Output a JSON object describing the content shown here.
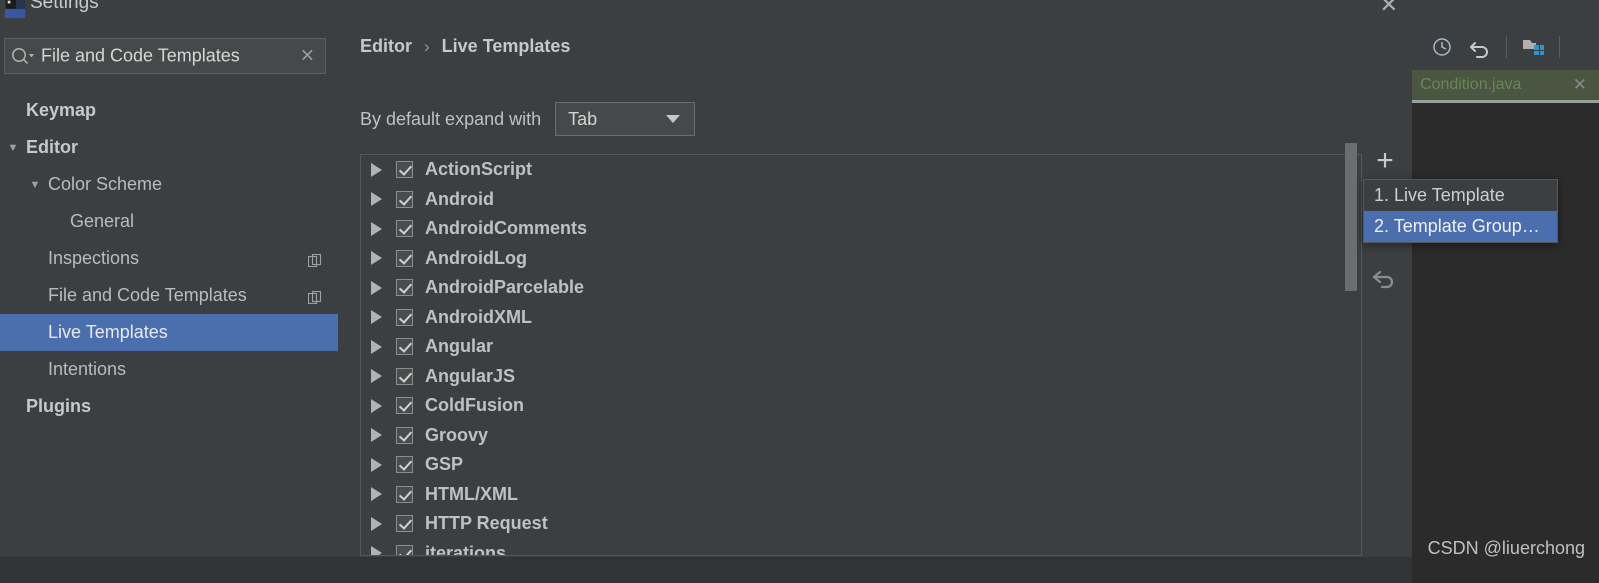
{
  "dialog": {
    "title": "Settings",
    "close_label": "✕",
    "logo_name": "intellij-logo-icon"
  },
  "search": {
    "value": "File and Code Templates",
    "clear_label": "✕"
  },
  "sidebar": {
    "items": [
      {
        "label": "Keymap",
        "indent": 0,
        "bold": true,
        "twisty": "",
        "selected": false,
        "copy": false
      },
      {
        "label": "Editor",
        "indent": 0,
        "bold": true,
        "twisty": "▼",
        "selected": false,
        "copy": false
      },
      {
        "label": "Color Scheme",
        "indent": 1,
        "bold": false,
        "twisty": "▼",
        "selected": false,
        "copy": false
      },
      {
        "label": "General",
        "indent": 2,
        "bold": false,
        "twisty": "",
        "selected": false,
        "copy": false
      },
      {
        "label": "Inspections",
        "indent": 1,
        "bold": false,
        "twisty": "",
        "selected": false,
        "copy": true
      },
      {
        "label": "File and Code Templates",
        "indent": 1,
        "bold": false,
        "twisty": "",
        "selected": false,
        "copy": true
      },
      {
        "label": "Live Templates",
        "indent": 1,
        "bold": false,
        "twisty": "",
        "selected": true,
        "copy": false
      },
      {
        "label": "Intentions",
        "indent": 1,
        "bold": false,
        "twisty": "",
        "selected": false,
        "copy": false
      },
      {
        "label": "Plugins",
        "indent": 0,
        "bold": true,
        "twisty": "",
        "selected": false,
        "copy": false
      }
    ]
  },
  "content": {
    "breadcrumb": {
      "parent": "Editor",
      "separator": "›",
      "current": "Live Templates"
    },
    "expand": {
      "label": "By default expand with",
      "selected": "Tab"
    },
    "templates": [
      {
        "label": "ActionScript",
        "checked": true
      },
      {
        "label": "Android",
        "checked": true
      },
      {
        "label": "AndroidComments",
        "checked": true
      },
      {
        "label": "AndroidLog",
        "checked": true
      },
      {
        "label": "AndroidParcelable",
        "checked": true
      },
      {
        "label": "AndroidXML",
        "checked": true
      },
      {
        "label": "Angular",
        "checked": true
      },
      {
        "label": "AngularJS",
        "checked": true
      },
      {
        "label": "ColdFusion",
        "checked": true
      },
      {
        "label": "Groovy",
        "checked": true
      },
      {
        "label": "GSP",
        "checked": true
      },
      {
        "label": "HTML/XML",
        "checked": true
      },
      {
        "label": "HTTP Request",
        "checked": true
      },
      {
        "label": "iterations",
        "checked": true
      }
    ]
  },
  "side_toolbar": {
    "add_label": "+"
  },
  "popup": {
    "items": [
      {
        "label": "1. Live Template",
        "highlighted": false
      },
      {
        "label": "2. Template Group…",
        "highlighted": true
      }
    ]
  },
  "ide": {
    "editor_tab": {
      "label": "Condition.java",
      "close_label": "✕"
    },
    "window_controls": {
      "minimize": "—",
      "maximize": "❐"
    }
  },
  "watermark": "CSDN @liuerchong",
  "colors": {
    "dialog_bg": "#3c3f41",
    "ide_bg": "#2b2b2b",
    "accent_selection": "#4b6eaf",
    "text_primary": "#c0c0c0",
    "tab_green_text": "#6a8759",
    "tab_green_bg": "#4a5641"
  }
}
